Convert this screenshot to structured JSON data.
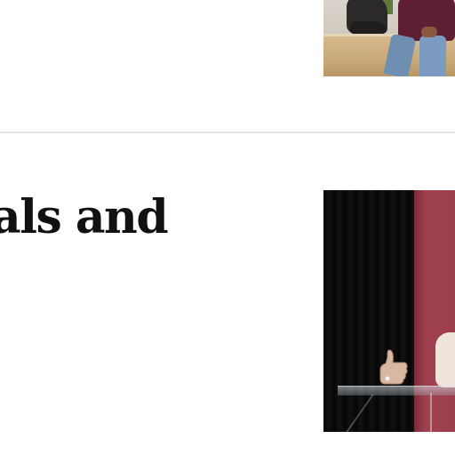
{
  "articles": [
    {
      "image": {
        "icon": "photo-student-sitting-by-statue"
      }
    },
    {
      "headline": "als and",
      "image": {
        "icon": "photo-speaker-at-podium"
      }
    }
  ],
  "colors": {
    "divider": "#e4e4e4",
    "headline_text": "#111111",
    "banner_maroon": "#9c3e4c"
  }
}
